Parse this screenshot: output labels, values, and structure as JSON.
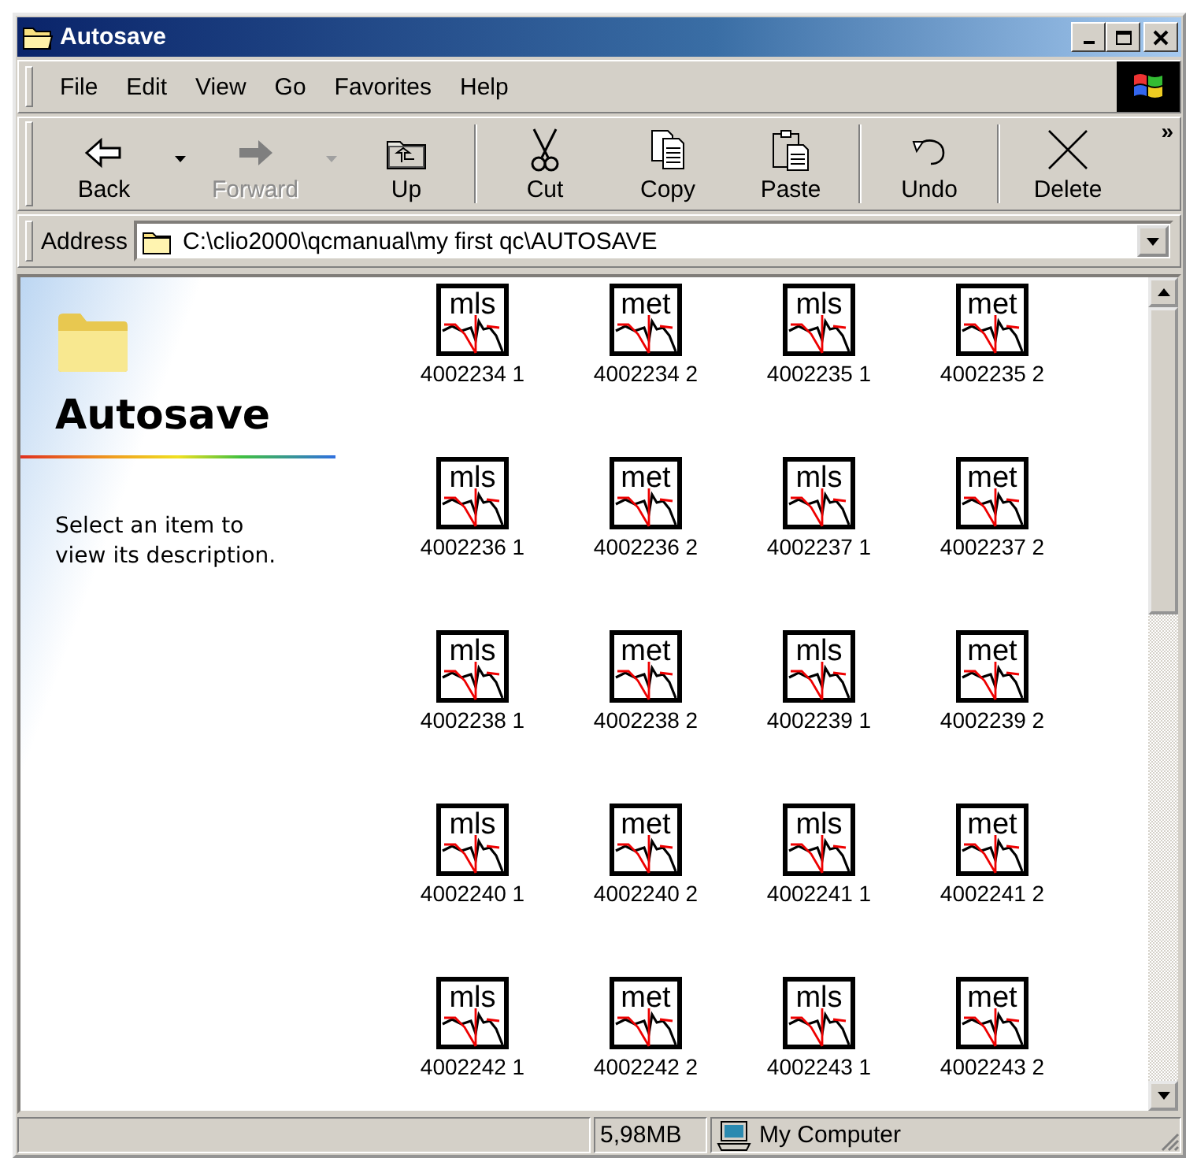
{
  "window": {
    "title": "Autosave"
  },
  "menu": {
    "items": [
      "File",
      "Edit",
      "View",
      "Go",
      "Favorites",
      "Help"
    ]
  },
  "toolbar": {
    "groups": [
      [
        {
          "kind": "back",
          "label": "Back",
          "disabled": false,
          "dropdown": true
        },
        {
          "kind": "forward",
          "label": "Forward",
          "disabled": true,
          "dropdown": true
        },
        {
          "kind": "up",
          "label": "Up",
          "disabled": false,
          "dropdown": false
        }
      ],
      [
        {
          "kind": "cut",
          "label": "Cut",
          "disabled": false,
          "dropdown": false
        },
        {
          "kind": "copy",
          "label": "Copy",
          "disabled": false,
          "dropdown": false
        },
        {
          "kind": "paste",
          "label": "Paste",
          "disabled": false,
          "dropdown": false
        }
      ],
      [
        {
          "kind": "undo",
          "label": "Undo",
          "disabled": false,
          "dropdown": false
        }
      ],
      [
        {
          "kind": "delete",
          "label": "Delete",
          "disabled": false,
          "dropdown": false
        }
      ]
    ],
    "overflow": "»"
  },
  "address": {
    "label": "Address",
    "value": "C:\\clio2000\\qcmanual\\my first qc\\AUTOSAVE"
  },
  "web_panel": {
    "title": "Autosave",
    "description": "Select an item to view its description."
  },
  "files": [
    {
      "name": "4002234 1",
      "icon_text": "mls"
    },
    {
      "name": "4002234 2",
      "icon_text": "met"
    },
    {
      "name": "4002235 1",
      "icon_text": "mls"
    },
    {
      "name": "4002235 2",
      "icon_text": "met"
    },
    {
      "name": "4002236 1",
      "icon_text": "mls"
    },
    {
      "name": "4002236 2",
      "icon_text": "met"
    },
    {
      "name": "4002237 1",
      "icon_text": "mls"
    },
    {
      "name": "4002237 2",
      "icon_text": "met"
    },
    {
      "name": "4002238 1",
      "icon_text": "mls"
    },
    {
      "name": "4002238 2",
      "icon_text": "met"
    },
    {
      "name": "4002239 1",
      "icon_text": "mls"
    },
    {
      "name": "4002239 2",
      "icon_text": "met"
    },
    {
      "name": "4002240 1",
      "icon_text": "mls"
    },
    {
      "name": "4002240 2",
      "icon_text": "met"
    },
    {
      "name": "4002241 1",
      "icon_text": "mls"
    },
    {
      "name": "4002241 2",
      "icon_text": "met"
    },
    {
      "name": "4002242 1",
      "icon_text": "mls"
    },
    {
      "name": "4002242 2",
      "icon_text": "met"
    },
    {
      "name": "4002243 1",
      "icon_text": "mls"
    },
    {
      "name": "4002243 2",
      "icon_text": "met"
    }
  ],
  "status_bar": {
    "size": "5,98MB",
    "zone": "My Computer"
  }
}
